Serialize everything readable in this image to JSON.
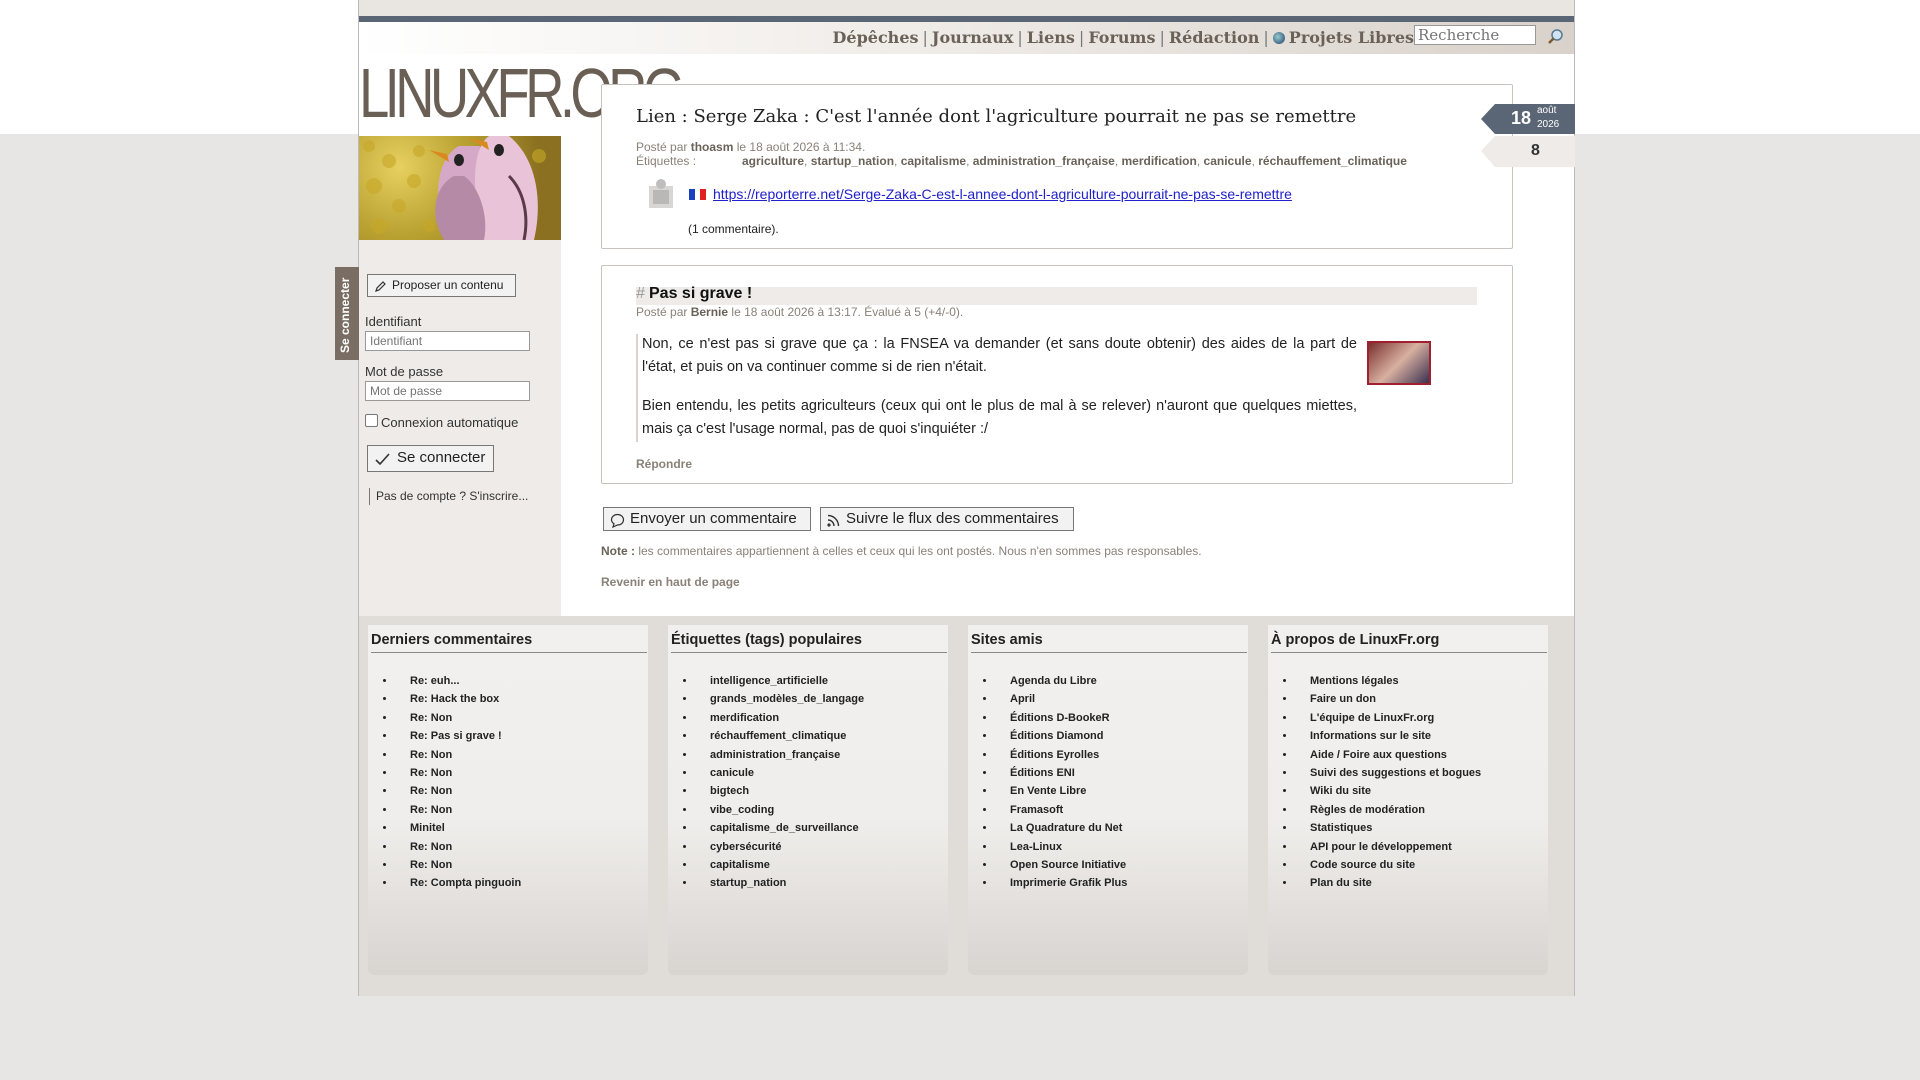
{
  "nav": {
    "items": [
      "Dépêches",
      "Journaux",
      "Liens",
      "Forums",
      "Rédaction",
      "Projets Libres"
    ],
    "search_placeholder": "Recherche"
  },
  "logo": {
    "text": "LINUXFR.ORG"
  },
  "sidebar": {
    "login_tab": "Se connecter",
    "propose_button": "Proposer un contenu",
    "identifiant_label": "Identifiant",
    "identifiant_placeholder": "Identifiant",
    "password_label": "Mot de passe",
    "password_placeholder": "Mot de passe",
    "auto_login_label": "Connexion automatique",
    "login_button": "Se connecter",
    "signup_link": "Pas de compte ? S'inscrire..."
  },
  "article": {
    "title": "Lien : Serge Zaka : C'est l'année dont l'agriculture pourrait ne pas se remettre",
    "posted_prefix": "Posté par",
    "author": "thoasm",
    "posted_suffix": "le 18 août 2026 à 11:34.",
    "tags_label": "Étiquettes :",
    "tags": [
      "agriculture",
      "startup_nation",
      "capitalisme",
      "administration_française",
      "merdification",
      "canicule",
      "réchauffement_climatique"
    ],
    "url": "https://reporterre.net/Serge-Zaka-C-est-l-annee-dont-l-agriculture-pourrait-ne-pas-se-remettre",
    "comments_count": "(1 commentaire).",
    "date_day": "18",
    "date_month": "août",
    "date_year": "2026",
    "score": "8"
  },
  "comment": {
    "hash": "#",
    "title": "Pas si grave !",
    "posted_prefix": "Posté par",
    "author": "Bernie",
    "posted_suffix": "le 18 août 2026 à 13:17. Évalué à 5 (+4/-0).",
    "paragraph1": "Non, ce n'est pas si grave que ça : la FNSEA va demander (et sans doute obtenir) des aides de la part de l'état, et puis on va continuer comme si de rien n'était.",
    "paragraph2": "Bien entendu, les petits agriculteurs (ceux qui ont le plus de mal à se relever) n'auront que quelques miettes, mais ça c'est l'usage normal, pas de quoi s'inquiéter :/",
    "reply": "Répondre"
  },
  "actions": {
    "send_comment": "Envoyer un commentaire",
    "follow_feed": "Suivre le flux des commentaires",
    "note_label": "Note :",
    "note_text": "les commentaires appartiennent à celles et ceux qui les ont postés. Nous n'en sommes pas responsables.",
    "back_to_top": "Revenir en haut de page"
  },
  "footer": {
    "columns": [
      {
        "title": "Derniers commentaires",
        "items": [
          "Re: euh...",
          "Re: Hack the box",
          "Re: Non",
          "Re: Pas si grave !",
          "Re: Non",
          "Re: Non",
          "Re: Non",
          "Re: Non",
          "Minitel",
          "Re: Non",
          "Re: Non",
          "Re: Compta pinguoin"
        ]
      },
      {
        "title": "Étiquettes (tags) populaires",
        "items": [
          "intelligence_artificielle",
          "grands_modèles_de_langage",
          "merdification",
          "réchauffement_climatique",
          "administration_française",
          "canicule",
          "bigtech",
          "vibe_coding",
          "capitalisme_de_surveillance",
          "cybersécurité",
          "capitalisme",
          "startup_nation"
        ]
      },
      {
        "title": "Sites amis",
        "items": [
          "Agenda du Libre",
          "April",
          "Éditions D-BookeR",
          "Éditions Diamond",
          "Éditions Eyrolles",
          "Éditions ENI",
          "En Vente Libre",
          "Framasoft",
          "La Quadrature du Net",
          "Lea-Linux",
          "Open Source Initiative",
          "Imprimerie Grafik Plus"
        ]
      },
      {
        "title": "À propos de LinuxFr.org",
        "items": [
          "Mentions légales",
          "Faire un don",
          "L'équipe de LinuxFr.org",
          "Informations sur le site",
          "Aide / Foire aux questions",
          "Suivi des suggestions et bogues",
          "Wiki du site",
          "Règles de modération",
          "Statistiques",
          "API pour le développement",
          "Code source du site",
          "Plan du site"
        ]
      }
    ]
  }
}
